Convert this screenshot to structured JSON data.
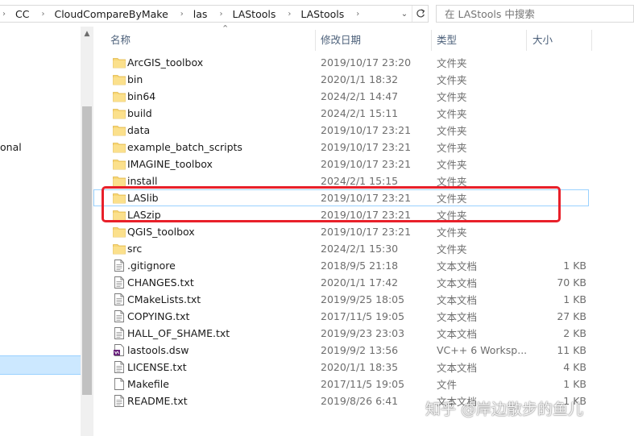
{
  "address_bar": {
    "breadcrumbs": [
      "CC",
      "CloudCompareByMake",
      "las",
      "LAStools",
      "LAStools"
    ],
    "search_placeholder": "在 LAStools 中搜索"
  },
  "nav_pane": {
    "partial_label": "onal"
  },
  "columns": {
    "name": "名称",
    "date": "修改日期",
    "type": "类型",
    "size": "大小"
  },
  "files": [
    {
      "name": "ArcGIS_toolbox",
      "date": "2019/10/17 23:20",
      "type": "文件夹",
      "size": "",
      "icon": "folder-icon"
    },
    {
      "name": "bin",
      "date": "2020/1/1 18:32",
      "type": "文件夹",
      "size": "",
      "icon": "folder-icon"
    },
    {
      "name": "bin64",
      "date": "2024/2/1 14:47",
      "type": "文件夹",
      "size": "",
      "icon": "folder-icon"
    },
    {
      "name": "build",
      "date": "2024/2/1 15:11",
      "type": "文件夹",
      "size": "",
      "icon": "folder-icon"
    },
    {
      "name": "data",
      "date": "2019/10/17 23:21",
      "type": "文件夹",
      "size": "",
      "icon": "folder-icon"
    },
    {
      "name": "example_batch_scripts",
      "date": "2019/10/17 23:21",
      "type": "文件夹",
      "size": "",
      "icon": "folder-icon"
    },
    {
      "name": "IMAGINE_toolbox",
      "date": "2019/10/17 23:21",
      "type": "文件夹",
      "size": "",
      "icon": "folder-icon"
    },
    {
      "name": "install",
      "date": "2024/2/1 15:15",
      "type": "文件夹",
      "size": "",
      "icon": "folder-icon"
    },
    {
      "name": "LASlib",
      "date": "2019/10/17 23:21",
      "type": "文件夹",
      "size": "",
      "icon": "folder-icon"
    },
    {
      "name": "LASzip",
      "date": "2019/10/17 23:21",
      "type": "文件夹",
      "size": "",
      "icon": "folder-icon"
    },
    {
      "name": "QGIS_toolbox",
      "date": "2019/10/17 23:21",
      "type": "文件夹",
      "size": "",
      "icon": "folder-icon"
    },
    {
      "name": "src",
      "date": "2024/2/1 15:30",
      "type": "文件夹",
      "size": "",
      "icon": "folder-icon"
    },
    {
      "name": ".gitignore",
      "date": "2018/9/5 21:18",
      "type": "文本文档",
      "size": "1 KB",
      "icon": "text-file-icon"
    },
    {
      "name": "CHANGES.txt",
      "date": "2020/1/1 17:42",
      "type": "文本文档",
      "size": "70 KB",
      "icon": "text-file-icon"
    },
    {
      "name": "CMakeLists.txt",
      "date": "2019/9/25 18:05",
      "type": "文本文档",
      "size": "1 KB",
      "icon": "text-file-icon"
    },
    {
      "name": "COPYING.txt",
      "date": "2017/11/5 19:05",
      "type": "文本文档",
      "size": "27 KB",
      "icon": "text-file-icon"
    },
    {
      "name": "HALL_OF_SHAME.txt",
      "date": "2019/9/23 23:03",
      "type": "文本文档",
      "size": "2 KB",
      "icon": "text-file-icon"
    },
    {
      "name": "lastools.dsw",
      "date": "2019/9/2 13:56",
      "type": "VC++ 6 Worksp...",
      "size": "11 KB",
      "icon": "visual-studio-file-icon"
    },
    {
      "name": "LICENSE.txt",
      "date": "2020/1/1 18:35",
      "type": "文本文档",
      "size": "4 KB",
      "icon": "text-file-icon"
    },
    {
      "name": "Makefile",
      "date": "2017/11/5 19:05",
      "type": "文件",
      "size": "1 KB",
      "icon": "blank-file-icon"
    },
    {
      "name": "README.txt",
      "date": "2019/8/26 6:41",
      "type": "文本文档",
      "size": "1 KB",
      "icon": "text-file-icon"
    }
  ],
  "watermark": "知乎 @岸边散步的鱼儿",
  "colors": {
    "folder": "#f8d775",
    "selection": "#cce8ff",
    "annotation": "#e8202a"
  }
}
